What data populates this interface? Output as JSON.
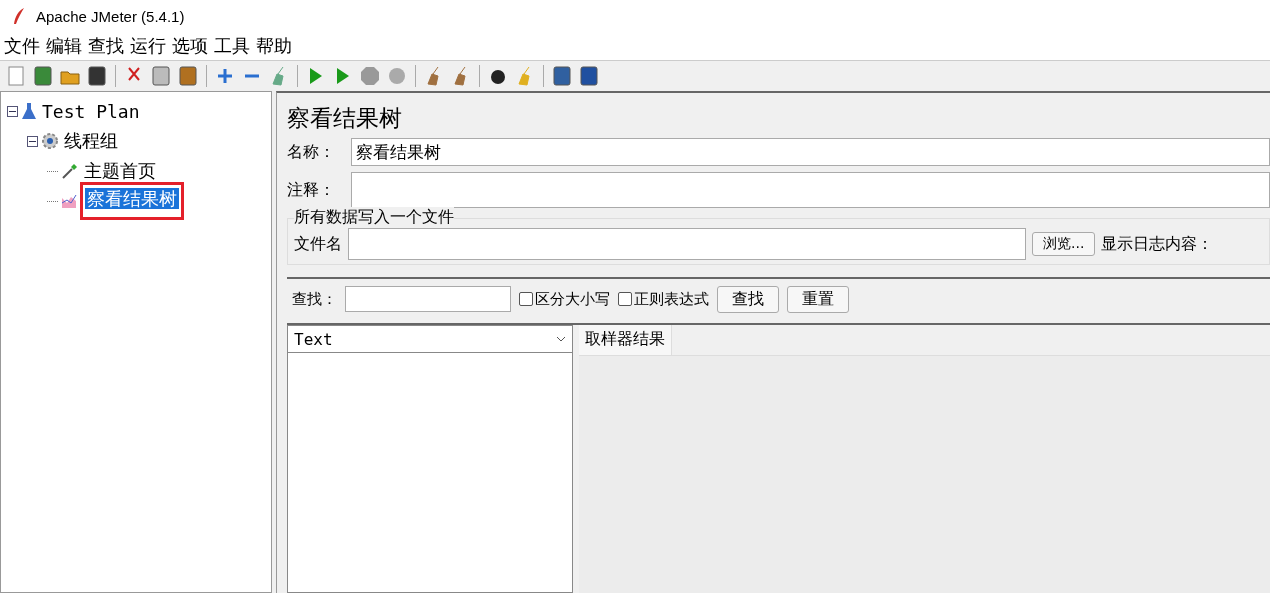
{
  "window": {
    "title": "Apache JMeter (5.4.1)"
  },
  "menu": [
    "文件",
    "编辑",
    "查找",
    "运行",
    "选项",
    "工具",
    "帮助"
  ],
  "tree": [
    {
      "label": "Test Plan",
      "kind": "flask",
      "expanded": true,
      "selected": false,
      "highlighted": false,
      "children": [
        {
          "label": "线程组",
          "kind": "gear",
          "expanded": true,
          "selected": false,
          "highlighted": false,
          "children": [
            {
              "label": "主题首页",
              "kind": "pipette",
              "selected": false,
              "highlighted": false
            },
            {
              "label": "察看结果树",
              "kind": "chart",
              "selected": true,
              "highlighted": true
            }
          ]
        }
      ]
    }
  ],
  "panel": {
    "title": "察看结果树",
    "name_label": "名称：",
    "name_value": "察看结果树",
    "comment_label": "注释：",
    "file_group": {
      "legend": "所有数据写入一个文件",
      "file_label": "文件名",
      "browse_button": "浏览...",
      "log_label": "显示日志内容："
    }
  },
  "search": {
    "label": "查找：",
    "options": [
      {
        "label": "区分大小写",
        "checked": false
      },
      {
        "label": "正则表达式",
        "checked": false
      }
    ],
    "buttons": [
      "查找",
      "重置"
    ]
  },
  "renderer": {
    "value": "Text"
  },
  "tabs": [
    {
      "label": "取样器结果",
      "selected": true
    }
  ]
}
